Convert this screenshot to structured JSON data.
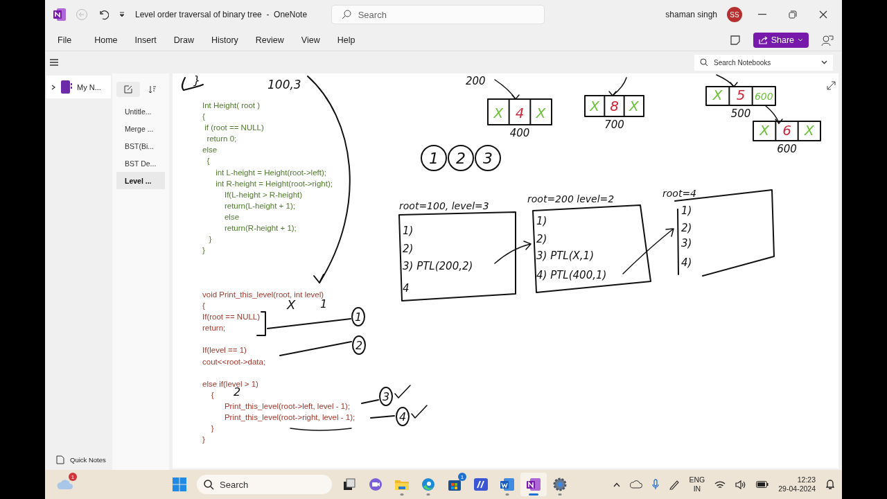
{
  "window": {
    "title": "Level order traversal of binary tree  -  OneNote",
    "search": {
      "placeholder": "Search"
    },
    "user": "shaman singh",
    "avatar": "SS"
  },
  "menu": [
    "File",
    "Home",
    "Insert",
    "Draw",
    "History",
    "Review",
    "View",
    "Help"
  ],
  "share_button": "Share",
  "notebook_search": {
    "placeholder": "Search Notebooks"
  },
  "notebooks": [
    {
      "label": "My N...",
      "expanded": false
    }
  ],
  "pages": [
    {
      "label": "Untitle...",
      "selected": false
    },
    {
      "label": "Merge ...",
      "selected": false
    },
    {
      "label": "BST(Bi...",
      "selected": false
    },
    {
      "label": "BST De...",
      "selected": false
    },
    {
      "label": "Level ...",
      "selected": true
    }
  ],
  "quick_notes": "Quick Notes",
  "code_blocks": [
    {
      "color": "#4f7a2b",
      "paragraphs": [
        [
          "Int Height( root )",
          "{",
          " if (root == NULL)",
          "  return 0;",
          "else",
          "  {",
          "      int L-height = Height(root->left);",
          "      int R-height = Height(root->right);",
          "          If(L-height > R-height)",
          "          return(L-height + 1);",
          "          else",
          "          return(R-height + 1);",
          "   }",
          "}"
        ]
      ]
    },
    {
      "color": "#a3392c",
      "paragraphs": [
        [
          "void Print_this_level(root, int level)",
          "{",
          "If(root == NULL)",
          "return;"
        ],
        [
          "If(level == 1)",
          "cout<<root->data;"
        ],
        [
          "else if(level > 1)",
          "    {",
          "          Print_this_level(root->left, level - 1);",
          "          Print_this_level(root->right, level - 1);",
          "    }",
          "}"
        ]
      ]
    }
  ],
  "ink": {
    "notes": [
      "}",
      "100,3",
      "200",
      "X",
      "1",
      "2"
    ],
    "nodes": [
      {
        "address": "400",
        "cells": [
          {
            "text": "X",
            "color": "#6cc13a"
          },
          {
            "text": "4",
            "color": "#d0263a"
          },
          {
            "text": "X",
            "color": "#6cc13a"
          }
        ]
      },
      {
        "address": "700",
        "cells": [
          {
            "text": "X",
            "color": "#6cc13a"
          },
          {
            "text": "8",
            "color": "#d0263a"
          },
          {
            "text": "X",
            "color": "#6cc13a"
          }
        ]
      },
      {
        "address": "500",
        "cells": [
          {
            "text": "X",
            "color": "#6cc13a"
          },
          {
            "text": "5",
            "color": "#d0263a"
          },
          {
            "text": "600",
            "color": "#6cc13a"
          }
        ]
      },
      {
        "address": "600",
        "cells": [
          {
            "text": "X",
            "color": "#6cc13a"
          },
          {
            "text": "6",
            "color": "#d0263a"
          },
          {
            "text": "X",
            "color": "#6cc13a"
          }
        ]
      }
    ],
    "circles": [
      "1",
      "2",
      "3"
    ],
    "frames": [
      {
        "heading": "root=100, level=3",
        "lines": [
          "1)",
          "2)",
          "3) PTL(200,2)",
          "4"
        ]
      },
      {
        "heading": "root=200 level=2",
        "lines": [
          "1)",
          "2)",
          "3) PTL(X,1)",
          "4) PTL(400,1)"
        ]
      },
      {
        "heading": "root=4",
        "lines": [
          "1)",
          "2)",
          "3)",
          "4)"
        ]
      }
    ],
    "steps": [
      {
        "label": "1",
        "checked": false
      },
      {
        "label": "2",
        "checked": false
      },
      {
        "label": "3",
        "checked": true
      },
      {
        "label": "4",
        "checked": true
      }
    ]
  },
  "taskbar": {
    "weather_badge": "1",
    "search": {
      "placeholder": "Search"
    },
    "apps": [
      {
        "kind": "taskview",
        "running": false,
        "active": false
      },
      {
        "kind": "chat",
        "running": false,
        "active": false
      },
      {
        "kind": "explorer",
        "running": true,
        "active": false
      },
      {
        "kind": "edge",
        "running": true,
        "active": false
      },
      {
        "kind": "store",
        "running": false,
        "active": false,
        "badge": "1"
      },
      {
        "kind": "vscode",
        "running": false,
        "active": false
      },
      {
        "kind": "word",
        "running": true,
        "active": false
      },
      {
        "kind": "onenote",
        "running": true,
        "active": true
      },
      {
        "kind": "settings",
        "running": true,
        "active": false
      }
    ],
    "language": "ENG",
    "region": "IN",
    "time": "12:23",
    "date": "29-04-2024"
  }
}
